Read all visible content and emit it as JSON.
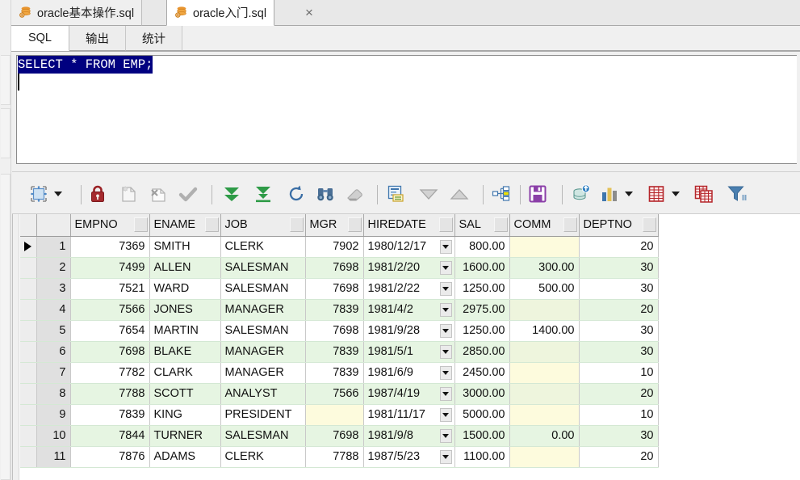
{
  "window": {
    "tabs": [
      {
        "label": "oracle基本操作.sql",
        "icon": "database-stack-icon",
        "active": false
      },
      {
        "label": "oracle入门.sql",
        "icon": "database-stack-icon",
        "active": true
      }
    ],
    "close_label": "×"
  },
  "subtabs": [
    {
      "label": "SQL",
      "active": true
    },
    {
      "label": "输出",
      "active": false
    },
    {
      "label": "统计",
      "active": false
    }
  ],
  "editor": {
    "selected_text": "SELECT * FROM EMP;",
    "selection_color": "#000080",
    "caret_line": 2
  },
  "toolbar": {
    "items": [
      {
        "name": "grid-layout-button",
        "icon": "grid-resize-icon",
        "enabled": true,
        "dropdown": true
      },
      {
        "name": "lock-record-button",
        "icon": "lock-icon",
        "enabled": true,
        "dropdown": false
      },
      {
        "name": "insert-record-button",
        "icon": "new-record-icon",
        "enabled": false,
        "dropdown": false
      },
      {
        "name": "delete-record-button",
        "icon": "delete-record-icon",
        "enabled": false,
        "dropdown": false
      },
      {
        "name": "post-changes-button",
        "icon": "checkmark-icon",
        "enabled": false,
        "dropdown": false
      },
      {
        "name": "fetch-next-page-button",
        "icon": "double-down-arrow-icon",
        "enabled": true,
        "dropdown": false
      },
      {
        "name": "fetch-all-rows-button",
        "icon": "down-arrow-to-bar-icon",
        "enabled": true,
        "dropdown": false
      },
      {
        "name": "refresh-button",
        "icon": "refresh-icon",
        "enabled": true,
        "dropdown": false
      },
      {
        "name": "find-button",
        "icon": "binoculars-icon",
        "enabled": true,
        "dropdown": false
      },
      {
        "name": "clear-filter-button",
        "icon": "eraser-icon",
        "enabled": false,
        "dropdown": false
      },
      {
        "name": "single-record-view-button",
        "icon": "record-form-icon",
        "enabled": true,
        "dropdown": false
      },
      {
        "name": "sort-descending-button",
        "icon": "triangle-down-icon",
        "enabled": false,
        "dropdown": false
      },
      {
        "name": "sort-ascending-button",
        "icon": "triangle-up-icon",
        "enabled": false,
        "dropdown": false
      },
      {
        "name": "master-detail-button",
        "icon": "hierarchy-icon",
        "enabled": true,
        "dropdown": false
      },
      {
        "name": "save-grid-button",
        "icon": "floppy-disk-icon",
        "enabled": true,
        "dropdown": false
      },
      {
        "name": "export-data-button",
        "icon": "database-export-icon",
        "enabled": true,
        "dropdown": false
      },
      {
        "name": "chart-button",
        "icon": "bar-chart-icon",
        "enabled": true,
        "dropdown": true
      },
      {
        "name": "grid-view-button",
        "icon": "red-table-icon",
        "enabled": true,
        "dropdown": true
      },
      {
        "name": "copy-table-button",
        "icon": "copy-table-icon",
        "enabled": true,
        "dropdown": false
      },
      {
        "name": "filter-button",
        "icon": "funnel-filter-icon",
        "enabled": true,
        "dropdown": false
      }
    ]
  },
  "grid": {
    "columns": [
      "EMPNO",
      "ENAME",
      "JOB",
      "MGR",
      "HIREDATE",
      "SAL",
      "COMM",
      "DEPTNO"
    ],
    "current_row": 1,
    "rows": [
      {
        "n": "1",
        "EMPNO": "7369",
        "ENAME": "SMITH",
        "JOB": "CLERK",
        "MGR": "7902",
        "HIREDATE": "1980/12/17",
        "SAL": "800.00",
        "COMM": "",
        "DEPTNO": "20"
      },
      {
        "n": "2",
        "EMPNO": "7499",
        "ENAME": "ALLEN",
        "JOB": "SALESMAN",
        "MGR": "7698",
        "HIREDATE": "1981/2/20",
        "SAL": "1600.00",
        "COMM": "300.00",
        "DEPTNO": "30"
      },
      {
        "n": "3",
        "EMPNO": "7521",
        "ENAME": "WARD",
        "JOB": "SALESMAN",
        "MGR": "7698",
        "HIREDATE": "1981/2/22",
        "SAL": "1250.00",
        "COMM": "500.00",
        "DEPTNO": "30"
      },
      {
        "n": "4",
        "EMPNO": "7566",
        "ENAME": "JONES",
        "JOB": "MANAGER",
        "MGR": "7839",
        "HIREDATE": "1981/4/2",
        "SAL": "2975.00",
        "COMM": "",
        "DEPTNO": "20"
      },
      {
        "n": "5",
        "EMPNO": "7654",
        "ENAME": "MARTIN",
        "JOB": "SALESMAN",
        "MGR": "7698",
        "HIREDATE": "1981/9/28",
        "SAL": "1250.00",
        "COMM": "1400.00",
        "DEPTNO": "30"
      },
      {
        "n": "6",
        "EMPNO": "7698",
        "ENAME": "BLAKE",
        "JOB": "MANAGER",
        "MGR": "7839",
        "HIREDATE": "1981/5/1",
        "SAL": "2850.00",
        "COMM": "",
        "DEPTNO": "30"
      },
      {
        "n": "7",
        "EMPNO": "7782",
        "ENAME": "CLARK",
        "JOB": "MANAGER",
        "MGR": "7839",
        "HIREDATE": "1981/6/9",
        "SAL": "2450.00",
        "COMM": "",
        "DEPTNO": "10"
      },
      {
        "n": "8",
        "EMPNO": "7788",
        "ENAME": "SCOTT",
        "JOB": "ANALYST",
        "MGR": "7566",
        "HIREDATE": "1987/4/19",
        "SAL": "3000.00",
        "COMM": "",
        "DEPTNO": "20"
      },
      {
        "n": "9",
        "EMPNO": "7839",
        "ENAME": "KING",
        "JOB": "PRESIDENT",
        "MGR": "",
        "HIREDATE": "1981/11/17",
        "SAL": "5000.00",
        "COMM": "",
        "DEPTNO": "10"
      },
      {
        "n": "10",
        "EMPNO": "7844",
        "ENAME": "TURNER",
        "JOB": "SALESMAN",
        "MGR": "7698",
        "HIREDATE": "1981/9/8",
        "SAL": "1500.00",
        "COMM": "0.00",
        "DEPTNO": "30"
      },
      {
        "n": "11",
        "EMPNO": "7876",
        "ENAME": "ADAMS",
        "JOB": "CLERK",
        "MGR": "7788",
        "HIREDATE": "1987/5/23",
        "SAL": "1100.00",
        "COMM": "",
        "DEPTNO": "20"
      }
    ]
  },
  "colors": {
    "alt_row": "#e6f5e2",
    "null_cell": "#fdfbdd",
    "selection": "#000080",
    "toolbar_bg": "#f0f0f0"
  }
}
